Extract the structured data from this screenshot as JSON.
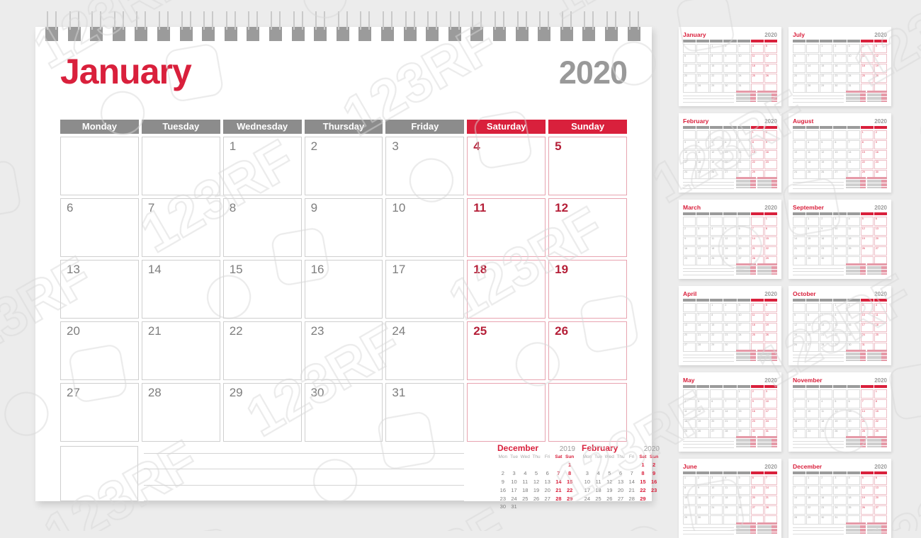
{
  "colors": {
    "red": "#d9203c",
    "dark_red": "#b51f38",
    "gray": "#8c8c8c",
    "year_gray": "#999999",
    "background": "#ececec",
    "page": "#ffffff"
  },
  "main": {
    "month": "January",
    "year": "2020",
    "weekdays": [
      {
        "label": "Monday",
        "weekend": false
      },
      {
        "label": "Tuesday",
        "weekend": false
      },
      {
        "label": "Wednesday",
        "weekend": false
      },
      {
        "label": "Thursday",
        "weekend": false
      },
      {
        "label": "Friday",
        "weekend": false
      },
      {
        "label": "Saturday",
        "weekend": true
      },
      {
        "label": "Sunday",
        "weekend": true
      }
    ],
    "weeks": [
      [
        "",
        "",
        "1",
        "2",
        "3",
        "4",
        "5"
      ],
      [
        "6",
        "7",
        "8",
        "9",
        "10",
        "11",
        "12"
      ],
      [
        "13",
        "14",
        "15",
        "16",
        "17",
        "18",
        "19"
      ],
      [
        "20",
        "21",
        "22",
        "23",
        "24",
        "25",
        "26"
      ],
      [
        "27",
        "28",
        "29",
        "30",
        "31",
        "",
        ""
      ]
    ],
    "notes_lines": 4
  },
  "mini_calendars": [
    {
      "month": "December",
      "year": "2019",
      "weekday_abbr": [
        "Mon",
        "Tue",
        "Wed",
        "Thu",
        "Fri",
        "Sat",
        "Sun"
      ],
      "weeks": [
        [
          "",
          "",
          "",
          "",
          "",
          "",
          "1"
        ],
        [
          "2",
          "3",
          "4",
          "5",
          "6",
          "7",
          "8"
        ],
        [
          "9",
          "10",
          "11",
          "12",
          "13",
          "14",
          "15"
        ],
        [
          "16",
          "17",
          "18",
          "19",
          "20",
          "21",
          "22"
        ],
        [
          "23",
          "24",
          "25",
          "26",
          "27",
          "28",
          "29"
        ],
        [
          "30",
          "31",
          "",
          "",
          "",
          "",
          ""
        ]
      ]
    },
    {
      "month": "February",
      "year": "2020",
      "weekday_abbr": [
        "Mon",
        "Tue",
        "Wed",
        "Thu",
        "Fri",
        "Sat",
        "Sun"
      ],
      "weeks": [
        [
          "",
          "",
          "",
          "",
          "",
          "1",
          "2"
        ],
        [
          "3",
          "4",
          "5",
          "6",
          "7",
          "8",
          "9"
        ],
        [
          "10",
          "11",
          "12",
          "13",
          "14",
          "15",
          "16"
        ],
        [
          "17",
          "18",
          "19",
          "20",
          "21",
          "22",
          "23"
        ],
        [
          "24",
          "25",
          "26",
          "27",
          "28",
          "29",
          ""
        ]
      ]
    }
  ],
  "thumbnails": [
    {
      "month": "January",
      "year": "2020",
      "weeks": [
        [
          "",
          "",
          "1",
          "2",
          "3",
          "4",
          "5"
        ],
        [
          "6",
          "7",
          "8",
          "9",
          "10",
          "11",
          "12"
        ],
        [
          "13",
          "14",
          "15",
          "16",
          "17",
          "18",
          "19"
        ],
        [
          "20",
          "21",
          "22",
          "23",
          "24",
          "25",
          "26"
        ],
        [
          "27",
          "28",
          "29",
          "30",
          "31",
          "",
          ""
        ]
      ]
    },
    {
      "month": "February",
      "year": "2020",
      "weeks": [
        [
          "",
          "",
          "",
          "",
          "",
          "1",
          "2"
        ],
        [
          "3",
          "4",
          "5",
          "6",
          "7",
          "8",
          "9"
        ],
        [
          "10",
          "11",
          "12",
          "13",
          "14",
          "15",
          "16"
        ],
        [
          "17",
          "18",
          "19",
          "20",
          "21",
          "22",
          "23"
        ],
        [
          "24",
          "25",
          "26",
          "27",
          "28",
          "29",
          ""
        ]
      ]
    },
    {
      "month": "March",
      "year": "2020",
      "weeks": [
        [
          "",
          "",
          "",
          "",
          "",
          "",
          "1"
        ],
        [
          "2",
          "3",
          "4",
          "5",
          "6",
          "7",
          "8"
        ],
        [
          "9",
          "10",
          "11",
          "12",
          "13",
          "14",
          "15"
        ],
        [
          "16",
          "17",
          "18",
          "19",
          "20",
          "21",
          "22"
        ],
        [
          "23",
          "24",
          "25",
          "26",
          "27",
          "28",
          "29"
        ],
        [
          "30",
          "31",
          "",
          "",
          "",
          "",
          ""
        ]
      ]
    },
    {
      "month": "April",
      "year": "2020",
      "weeks": [
        [
          "",
          "",
          "1",
          "2",
          "3",
          "4",
          "5"
        ],
        [
          "6",
          "7",
          "8",
          "9",
          "10",
          "11",
          "12"
        ],
        [
          "13",
          "14",
          "15",
          "16",
          "17",
          "18",
          "19"
        ],
        [
          "20",
          "21",
          "22",
          "23",
          "24",
          "25",
          "26"
        ],
        [
          "27",
          "28",
          "29",
          "30",
          "",
          "",
          ""
        ]
      ]
    },
    {
      "month": "May",
      "year": "2020",
      "weeks": [
        [
          "",
          "",
          "",
          "",
          "1",
          "2",
          "3"
        ],
        [
          "4",
          "5",
          "6",
          "7",
          "8",
          "9",
          "10"
        ],
        [
          "11",
          "12",
          "13",
          "14",
          "15",
          "16",
          "17"
        ],
        [
          "18",
          "19",
          "20",
          "21",
          "22",
          "23",
          "24"
        ],
        [
          "25",
          "26",
          "27",
          "28",
          "29",
          "30",
          "31"
        ]
      ]
    },
    {
      "month": "June",
      "year": "2020",
      "weeks": [
        [
          "1",
          "2",
          "3",
          "4",
          "5",
          "6",
          "7"
        ],
        [
          "8",
          "9",
          "10",
          "11",
          "12",
          "13",
          "14"
        ],
        [
          "15",
          "16",
          "17",
          "18",
          "19",
          "20",
          "21"
        ],
        [
          "22",
          "23",
          "24",
          "25",
          "26",
          "27",
          "28"
        ],
        [
          "29",
          "30",
          "",
          "",
          "",
          "",
          ""
        ]
      ]
    },
    {
      "month": "July",
      "year": "2020",
      "weeks": [
        [
          "",
          "",
          "1",
          "2",
          "3",
          "4",
          "5"
        ],
        [
          "6",
          "7",
          "8",
          "9",
          "10",
          "11",
          "12"
        ],
        [
          "13",
          "14",
          "15",
          "16",
          "17",
          "18",
          "19"
        ],
        [
          "20",
          "21",
          "22",
          "23",
          "24",
          "25",
          "26"
        ],
        [
          "27",
          "28",
          "29",
          "30",
          "31",
          "",
          ""
        ]
      ]
    },
    {
      "month": "August",
      "year": "2020",
      "weeks": [
        [
          "",
          "",
          "",
          "",
          "",
          "1",
          "2"
        ],
        [
          "3",
          "4",
          "5",
          "6",
          "7",
          "8",
          "9"
        ],
        [
          "10",
          "11",
          "12",
          "13",
          "14",
          "15",
          "16"
        ],
        [
          "17",
          "18",
          "19",
          "20",
          "21",
          "22",
          "23"
        ],
        [
          "24",
          "25",
          "26",
          "27",
          "28",
          "29",
          "30"
        ],
        [
          "31",
          "",
          "",
          "",
          "",
          "",
          ""
        ]
      ]
    },
    {
      "month": "September",
      "year": "2020",
      "weeks": [
        [
          "",
          "1",
          "2",
          "3",
          "4",
          "5",
          "6"
        ],
        [
          "7",
          "8",
          "9",
          "10",
          "11",
          "12",
          "13"
        ],
        [
          "14",
          "15",
          "16",
          "17",
          "18",
          "19",
          "20"
        ],
        [
          "21",
          "22",
          "23",
          "24",
          "25",
          "26",
          "27"
        ],
        [
          "28",
          "29",
          "30",
          "",
          "",
          "",
          ""
        ]
      ]
    },
    {
      "month": "October",
      "year": "2020",
      "weeks": [
        [
          "",
          "",
          "",
          "1",
          "2",
          "3",
          "4"
        ],
        [
          "5",
          "6",
          "7",
          "8",
          "9",
          "10",
          "11"
        ],
        [
          "12",
          "13",
          "14",
          "15",
          "16",
          "17",
          "18"
        ],
        [
          "19",
          "20",
          "21",
          "22",
          "23",
          "24",
          "25"
        ],
        [
          "26",
          "27",
          "28",
          "29",
          "30",
          "31",
          ""
        ]
      ]
    },
    {
      "month": "November",
      "year": "2020",
      "weeks": [
        [
          "",
          "",
          "",
          "",
          "",
          "",
          "1"
        ],
        [
          "2",
          "3",
          "4",
          "5",
          "6",
          "7",
          "8"
        ],
        [
          "9",
          "10",
          "11",
          "12",
          "13",
          "14",
          "15"
        ],
        [
          "16",
          "17",
          "18",
          "19",
          "20",
          "21",
          "22"
        ],
        [
          "23",
          "24",
          "25",
          "26",
          "27",
          "28",
          "29"
        ],
        [
          "30",
          "",
          "",
          "",
          "",
          "",
          ""
        ]
      ]
    },
    {
      "month": "December",
      "year": "2020",
      "weeks": [
        [
          "",
          "1",
          "2",
          "3",
          "4",
          "5",
          "6"
        ],
        [
          "7",
          "8",
          "9",
          "10",
          "11",
          "12",
          "13"
        ],
        [
          "14",
          "15",
          "16",
          "17",
          "18",
          "19",
          "20"
        ],
        [
          "21",
          "22",
          "23",
          "24",
          "25",
          "26",
          "27"
        ],
        [
          "28",
          "29",
          "30",
          "31",
          "",
          "",
          ""
        ]
      ]
    }
  ],
  "watermark": {
    "text": "123RF"
  }
}
